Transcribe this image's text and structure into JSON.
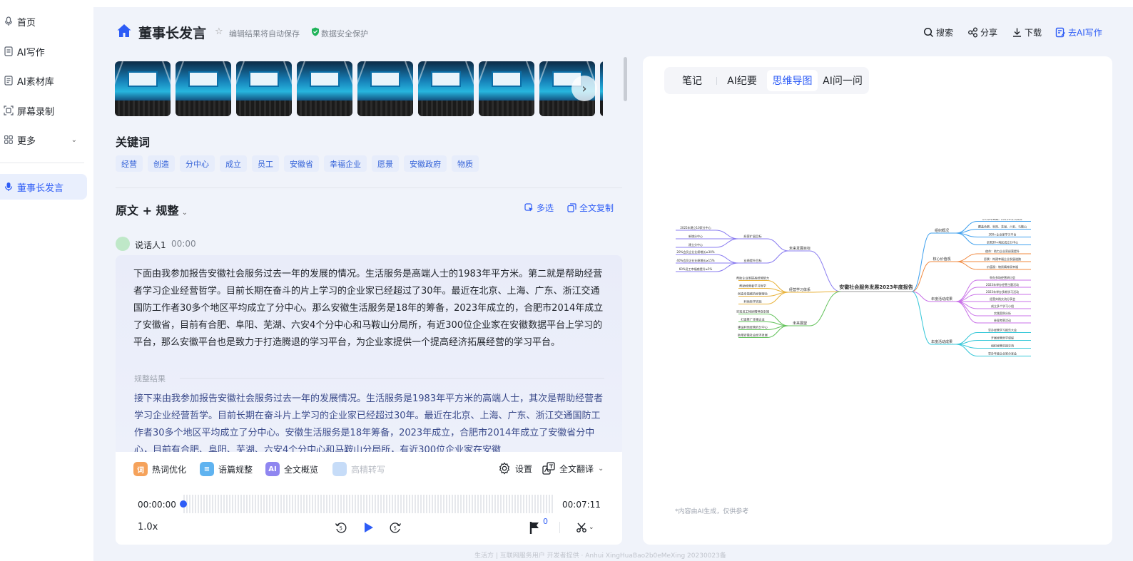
{
  "sidebar": {
    "items": [
      {
        "label": "首页",
        "icon": "mic-icon"
      },
      {
        "label": "AI写作",
        "icon": "doc-icon"
      },
      {
        "label": "AI素材库",
        "icon": "library-icon"
      },
      {
        "label": "屏幕录制",
        "icon": "screen-record-icon"
      },
      {
        "label": "更多",
        "icon": "grid-icon"
      },
      {
        "label": "董事长发言",
        "icon": "mic-icon"
      }
    ]
  },
  "header": {
    "title": "董事长发言",
    "autosave": "编辑结果将自动保存",
    "security": "数据安全保护",
    "actions": {
      "search": "搜索",
      "share": "分享",
      "download": "下载",
      "ai_write": "去AI写作"
    }
  },
  "keywords": {
    "title": "关键词",
    "items": [
      "经营",
      "创造",
      "分中心",
      "成立",
      "员工",
      "安徽省",
      "幸福企业",
      "愿景",
      "安徽政府",
      "物质"
    ]
  },
  "section": {
    "title": "原文 + 规整",
    "multi_select": "多选",
    "copy_all": "全文复制"
  },
  "speaker": {
    "name": "说话人1",
    "time": "00:00"
  },
  "transcript": {
    "original": "下面由我参加报告安徽社会服务过去一年的发展的情况。生活服务是高端人士的1983年平方米。第二就是帮助经营者学习企业经营哲学。目前长期在奋斗的片上学习的企业家已经超过了30年。最近在北京、上海、广东、浙江交通国防工作者30多个地区平均成立了分中心。那么安徽生活服务是18年的筹备，2023年成立的，合肥市2014年成立了安徽省，目前有合肥、阜阳、芜湖、六安4个分中心和马鞍山分局所，有近300位企业家在安徽数据平台上学习的平台，那么安徽平台也是致力于打造腾退的学习平台，为企业家提供一个提高经济拓展经营的学习平台。",
    "regulated_label": "规整结果",
    "regulated": "接下来由我参加报告安徽社会服务过去一年的发展情况。生活服务是1983年平方米的高端人士，其次是帮助经营者学习企业经营哲学。目前长期在奋斗片上学习的企业家已经超过30年。最近在北京、上海、广东、浙江交通国防工作者30多个地区平均成立了分中心。安徽生活服务是18年筹备，2023年成立，合肥市2014年成立了安徽省分中心，目前有合肥、阜阳、芜湖、六安4个分中心和马鞍山分局所，有近300位企业家在安徽"
  },
  "toolbar": {
    "hotword": "热词优化",
    "paragraph": "语篇规整",
    "summary": "全文概览",
    "rewrite": "高精转写",
    "settings": "设置",
    "translate": "全文翻译"
  },
  "player": {
    "start": "00:00:00",
    "end": "00:07:11",
    "speed": "1.0x",
    "flag_count": "0",
    "progress": 0
  },
  "right_panel": {
    "tabs": [
      "笔记",
      "AI纪要",
      "思维导图",
      "AI问一问"
    ],
    "active_tab": "思维导图",
    "mindmap": {
      "root": "安徽社会服务发展2023年度报告",
      "left_branches": [
        {
          "label": "未来发展目标",
          "children": [
            {
              "label": "经营扩展目标",
              "leaves": [
                "2025年建立10家分中心",
                "新增分中心",
                "建立分中心"
              ]
            },
            {
              "label": "业绩提升目标",
              "leaves": [
                "20%会员企业业绩增长≥30%",
                "40%会员企业业绩增长≥15%",
                "60%员工幸福感提升≥5%"
              ]
            }
          ]
        },
        {
          "label": "经营学习体系",
          "children": [
            {
              "label": "帮助企业家提高经营能力",
              "leaves": []
            },
            {
              "label": "帮助经营者学习哲学",
              "leaves": []
            },
            {
              "label": "创造幸福感的经营理念",
              "leaves": []
            },
            {
              "label": "利他哲学实践",
              "leaves": []
            }
          ]
        },
        {
          "label": "未来展望",
          "children": [
            {
              "label": "实现员工物质精神双幸福",
              "leaves": []
            },
            {
              "label": "打造推广幸福企业",
              "leaves": []
            },
            {
              "label": "建设利他经营的分中心",
              "leaves": []
            },
            {
              "label": "助推安徽社会经济发展",
              "leaves": []
            }
          ]
        }
      ],
      "right_branches": [
        {
          "label": "组织概况",
          "leaves": [
            "2018年筹备，2023年正式成立",
            "覆盖合肥、阜阳、芜湖、六安、马鞍山",
            "300+企业家学习平台",
            "全国30+地区成立分中心"
          ]
        },
        {
          "label": "核心价值观",
          "leaves": [
            "使命：助力企业家经营提升",
            "愿景：构建幸福企业发展道路",
            "价值观：物质精神双幸福"
          ]
        },
        {
          "label": "年度活动成果",
          "leaves": [
            "举办多场经营研讨会",
            "2023年举办经营主题活动",
            "2023年举办多期学习活动",
            "经营实践交流分享会",
            "成立多个学习小组",
            "实践案例分析",
            "参观考察活动"
          ]
        },
        {
          "label": "年度活动成果",
          "leaves": [
            "举办经营学习报告大会",
            "开展经营哲学课程",
            "组织经营实践交流",
            "举办年度企业家分享会"
          ]
        }
      ]
    },
    "disclaimer": "*内容由AI生成，仅供参考"
  },
  "footer": "生活方 | 互联网服务用户 开发者提供 · Anhui XingHuaBao2b0eMeXing 20230023备"
}
